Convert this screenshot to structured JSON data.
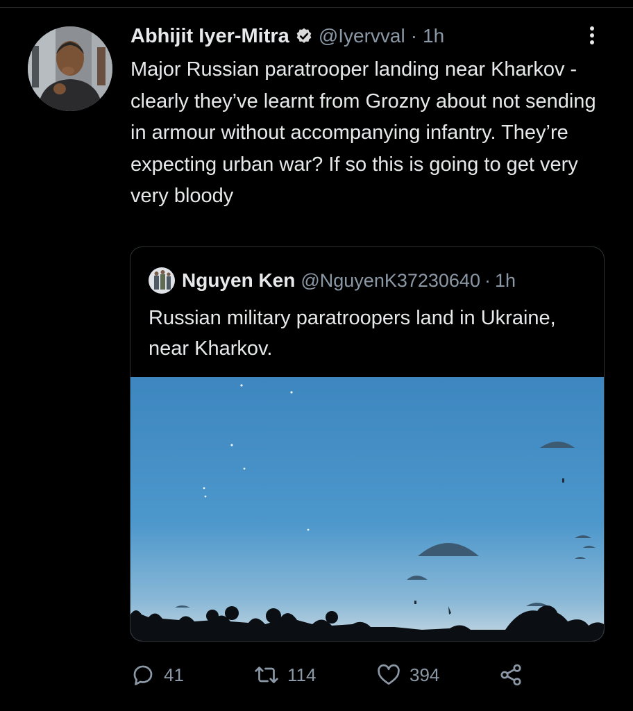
{
  "tweet": {
    "author_name": "Abhijit Iyer-Mitra",
    "handle": "@Iyervval",
    "separator": "·",
    "time": "1h",
    "text": "Major Russian paratrooper landing near Kharkov - clearly they’ve learnt from Grozny about not sending in armour without accompanying infantry. They’re expecting urban war? If so this is going to get very very bloody"
  },
  "quoted": {
    "author_name": "Nguyen Ken",
    "handle": "@NguyenK37230640",
    "separator": "·",
    "time": "1h",
    "text": "Russian military paratroopers land in Ukraine, near Kharkov."
  },
  "actions": {
    "replies": "41",
    "retweets": "114",
    "likes": "394"
  },
  "icons": [
    "verified-icon",
    "more-icon",
    "reply-icon",
    "retweet-icon",
    "like-icon",
    "share-icon"
  ],
  "colors": {
    "background": "#000000",
    "text": "#e7e9ea",
    "secondary_text": "#8b98a5",
    "border": "#2f3336",
    "sky": "#3d86bf"
  }
}
